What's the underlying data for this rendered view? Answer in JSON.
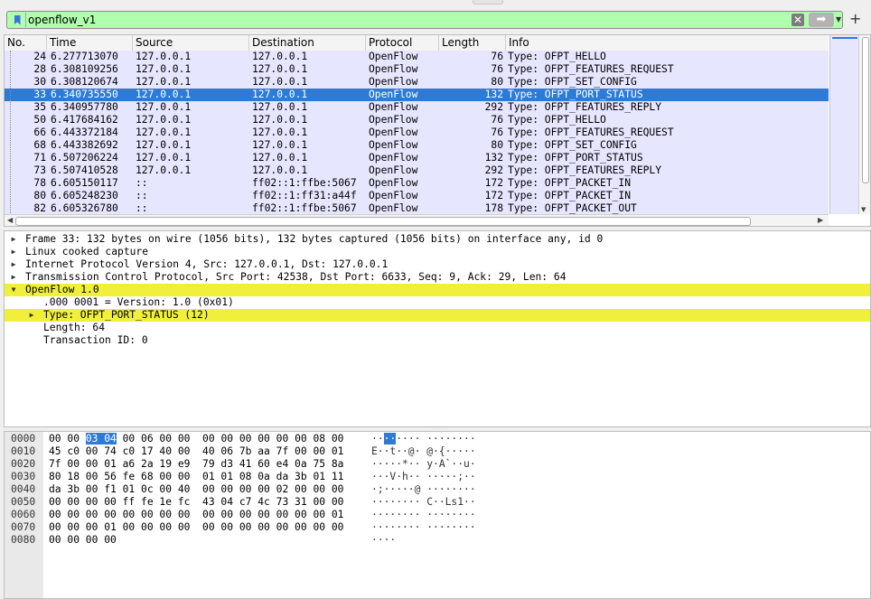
{
  "filter": {
    "value": "openflow_v1",
    "apply_icon": "arrow-right-icon",
    "clear_icon": "clear-icon",
    "plus": "+"
  },
  "packet_list": {
    "columns": [
      "No.",
      "Time",
      "Source",
      "Destination",
      "Protocol",
      "Length",
      "Info"
    ],
    "rows": [
      {
        "no": "24",
        "time": "6.277713070",
        "src": "127.0.0.1",
        "dst": "127.0.0.1",
        "proto": "OpenFlow",
        "len": "76",
        "info": "Type: OFPT_HELLO"
      },
      {
        "no": "28",
        "time": "6.308109256",
        "src": "127.0.0.1",
        "dst": "127.0.0.1",
        "proto": "OpenFlow",
        "len": "76",
        "info": "Type: OFPT_FEATURES_REQUEST"
      },
      {
        "no": "30",
        "time": "6.308120674",
        "src": "127.0.0.1",
        "dst": "127.0.0.1",
        "proto": "OpenFlow",
        "len": "80",
        "info": "Type: OFPT_SET_CONFIG"
      },
      {
        "no": "33",
        "time": "6.340735550",
        "src": "127.0.0.1",
        "dst": "127.0.0.1",
        "proto": "OpenFlow",
        "len": "132",
        "info": "Type: OFPT_PORT_STATUS",
        "selected": true
      },
      {
        "no": "35",
        "time": "6.340957780",
        "src": "127.0.0.1",
        "dst": "127.0.0.1",
        "proto": "OpenFlow",
        "len": "292",
        "info": "Type: OFPT_FEATURES_REPLY"
      },
      {
        "no": "50",
        "time": "6.417684162",
        "src": "127.0.0.1",
        "dst": "127.0.0.1",
        "proto": "OpenFlow",
        "len": "76",
        "info": "Type: OFPT_HELLO"
      },
      {
        "no": "66",
        "time": "6.443372184",
        "src": "127.0.0.1",
        "dst": "127.0.0.1",
        "proto": "OpenFlow",
        "len": "76",
        "info": "Type: OFPT_FEATURES_REQUEST"
      },
      {
        "no": "68",
        "time": "6.443382692",
        "src": "127.0.0.1",
        "dst": "127.0.0.1",
        "proto": "OpenFlow",
        "len": "80",
        "info": "Type: OFPT_SET_CONFIG"
      },
      {
        "no": "71",
        "time": "6.507206224",
        "src": "127.0.0.1",
        "dst": "127.0.0.1",
        "proto": "OpenFlow",
        "len": "132",
        "info": "Type: OFPT_PORT_STATUS"
      },
      {
        "no": "73",
        "time": "6.507410528",
        "src": "127.0.0.1",
        "dst": "127.0.0.1",
        "proto": "OpenFlow",
        "len": "292",
        "info": "Type: OFPT_FEATURES_REPLY"
      },
      {
        "no": "78",
        "time": "6.605150117",
        "src": "::",
        "dst": "ff02::1:ffbe:5067",
        "proto": "OpenFlow",
        "len": "172",
        "info": "Type: OFPT_PACKET_IN"
      },
      {
        "no": "80",
        "time": "6.605248230",
        "src": "::",
        "dst": "ff02::1:ff31:a44f",
        "proto": "OpenFlow",
        "len": "172",
        "info": "Type: OFPT_PACKET_IN"
      },
      {
        "no": "82",
        "time": "6.605326780",
        "src": "::",
        "dst": "ff02::1:ffbe:5067",
        "proto": "OpenFlow",
        "len": "178",
        "info": "Type: OFPT_PACKET_OUT"
      }
    ]
  },
  "details": {
    "rows": [
      {
        "text": "Frame 33: 132 bytes on wire (1056 bits), 132 bytes captured (1056 bits) on interface any, id 0",
        "arrow": "collapsed",
        "level": 0
      },
      {
        "text": "Linux cooked capture",
        "arrow": "collapsed",
        "level": 0
      },
      {
        "text": "Internet Protocol Version 4, Src: 127.0.0.1, Dst: 127.0.0.1",
        "arrow": "collapsed",
        "level": 0
      },
      {
        "text": "Transmission Control Protocol, Src Port: 42538, Dst Port: 6633, Seq: 9, Ack: 29, Len: 64",
        "arrow": "collapsed",
        "level": 0
      },
      {
        "text": "OpenFlow 1.0",
        "arrow": "expanded",
        "level": 0,
        "highlight": true
      },
      {
        "text": ".000 0001 = Version: 1.0 (0x01)",
        "arrow": "none",
        "level": 1
      },
      {
        "text": "Type: OFPT_PORT_STATUS (12)",
        "arrow": "collapsed",
        "level": 1,
        "highlight": true
      },
      {
        "text": "Length: 64",
        "arrow": "none",
        "level": 1
      },
      {
        "text": "Transaction ID: 0",
        "arrow": "none",
        "level": 1
      }
    ]
  },
  "bytes": {
    "rows": [
      {
        "off": "0000",
        "pre": "00 00 ",
        "sel": "03 04",
        "post": " 00 06 00 00  00 00 00 00 00 00 08 00",
        "apre": "··",
        "asel": "··",
        "apost": "···· ········"
      },
      {
        "off": "0010",
        "pre": "45 c0 00 74 c0 17 40 00  40 06 7b aa 7f 00 00 01",
        "sel": "",
        "post": "",
        "apre": "E··t··@· @·{·····",
        "asel": "",
        "apost": ""
      },
      {
        "off": "0020",
        "pre": "7f 00 00 01 a6 2a 19 e9  79 d3 41 60 e4 0a 75 8a",
        "sel": "",
        "post": "",
        "apre": "·····*·· y·A`··u·",
        "asel": "",
        "apost": ""
      },
      {
        "off": "0030",
        "pre": "80 18 00 56 fe 68 00 00  01 01 08 0a da 3b 01 11",
        "sel": "",
        "post": "",
        "apre": "···V·h·· ·····;··",
        "asel": "",
        "apost": ""
      },
      {
        "off": "0040",
        "pre": "da 3b 00 f1 01 0c 00 40  00 00 00 00 02 00 00 00",
        "sel": "",
        "post": "",
        "apre": "·;·····@ ········",
        "asel": "",
        "apost": ""
      },
      {
        "off": "0050",
        "pre": "00 00 00 00 ff fe 1e fc  43 04 c7 4c 73 31 00 00",
        "sel": "",
        "post": "",
        "apre": "········ C··Ls1··",
        "asel": "",
        "apost": ""
      },
      {
        "off": "0060",
        "pre": "00 00 00 00 00 00 00 00  00 00 00 00 00 00 00 01",
        "sel": "",
        "post": "",
        "apre": "········ ········",
        "asel": "",
        "apost": ""
      },
      {
        "off": "0070",
        "pre": "00 00 00 01 00 00 00 00  00 00 00 00 00 00 00 00",
        "sel": "",
        "post": "",
        "apre": "········ ········",
        "asel": "",
        "apost": ""
      },
      {
        "off": "0080",
        "pre": "00 00 00 00",
        "sel": "",
        "post": "",
        "apre": "····",
        "asel": "",
        "apost": ""
      }
    ]
  },
  "colors": {
    "row_bg": "#e7e6ff",
    "selected_bg": "#2f7bd3",
    "filter_ok": "#afffaf",
    "highlight": "#f0f03c"
  }
}
